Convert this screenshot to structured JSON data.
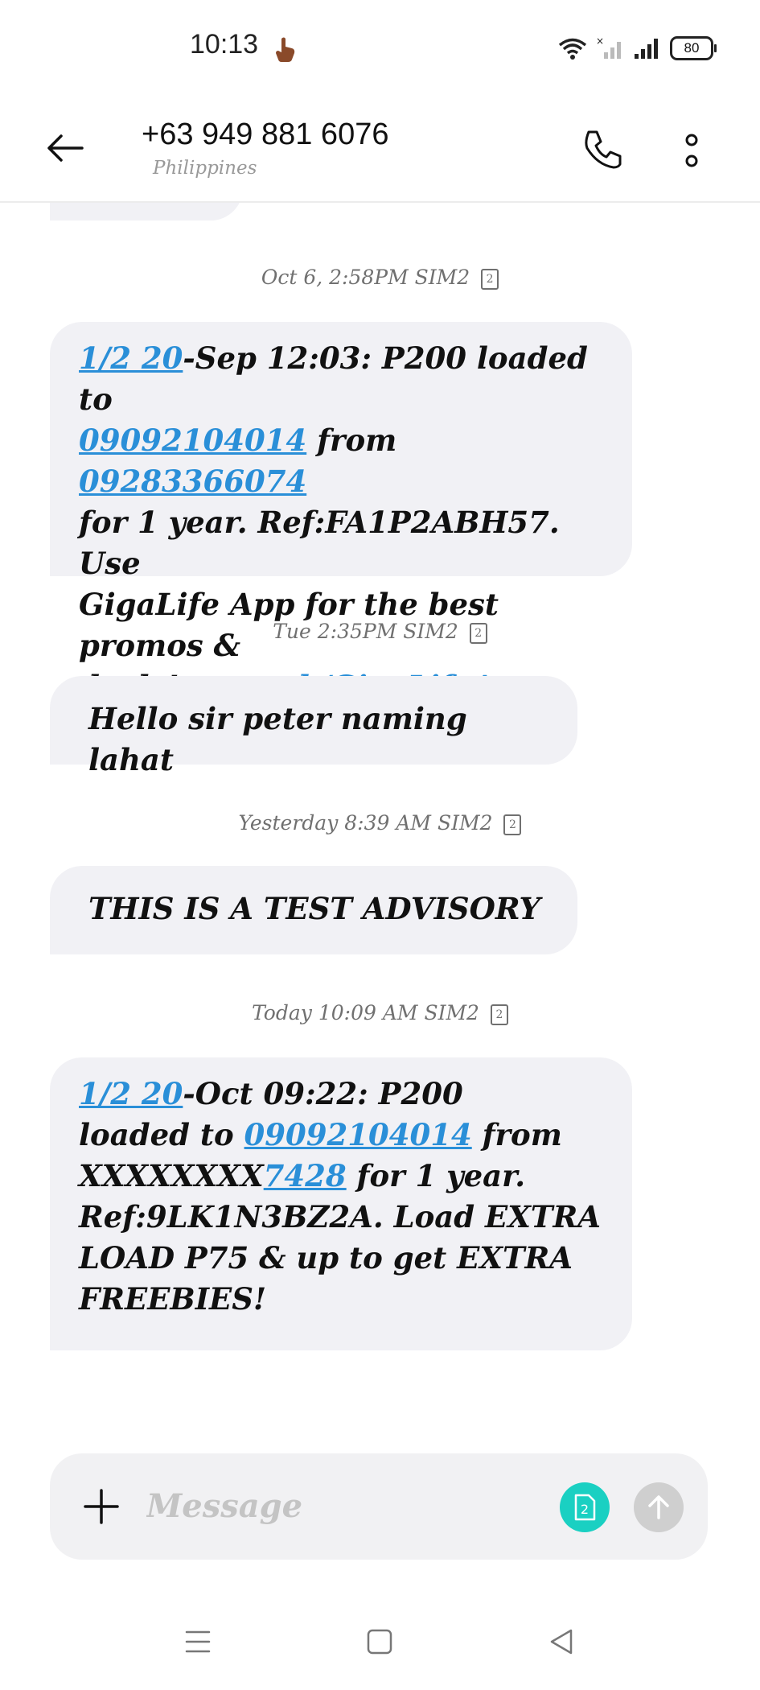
{
  "status_bar": {
    "time": "10:13",
    "battery": "80"
  },
  "header": {
    "contact_number": "+63 949 881 6076",
    "contact_location": "Philippines"
  },
  "thread": {
    "messages": [
      {
        "timestamp": "Oct 6, 2:58PM",
        "sim": "SIM2",
        "sim_badge": "2",
        "parts": {
          "t0": "1/2 20",
          "t1": "-Sep 12:03: P200 loaded to",
          "t2": "09092104014",
          "t3": " from ",
          "t4": "09283366074",
          "t5": "for 1 year. Ref:FA1P2ABH57. Use",
          "t6": "GigaLife App for the best promos &",
          "t7": "deals! ",
          "t8": "smrt.ph/GigaLifeApp"
        }
      },
      {
        "timestamp": "Tue 2:35PM",
        "sim": "SIM2",
        "sim_badge": "2",
        "text": "Hello sir peter naming lahat"
      },
      {
        "timestamp": "Yesterday 8:39 AM",
        "sim": "SIM2",
        "sim_badge": "2",
        "text": "THIS IS A TEST ADVISORY"
      },
      {
        "timestamp": "Today 10:09 AM",
        "sim": "SIM2",
        "sim_badge": "2",
        "parts": {
          "t0": "1/2 20",
          "t1": "-Oct 09:22: P200",
          "t2": "loaded to ",
          "t3": "09092104014",
          "t4": " from",
          "t5": "XXXXXXXX",
          "t6": "7428",
          "t7": " for 1 year.",
          "t8": "Ref:9LK1N3BZ2A. Load EXTRA",
          "t9": "LOAD P75 & up to get EXTRA",
          "t10": "FREEBIES!"
        }
      }
    ]
  },
  "composer": {
    "placeholder": "Message",
    "sim_button": "2"
  },
  "colors": {
    "link": "#2a8fd8",
    "bubble": "#f1f1f5",
    "sim_button": "#1ad0c2",
    "send_button_disabled": "#cfcfcf"
  },
  "icons": {
    "back": "arrow-left-icon",
    "call": "phone-icon",
    "more": "more-vertical-icon",
    "add": "plus-icon",
    "sim": "sim-card-icon",
    "send": "arrow-up-icon"
  }
}
